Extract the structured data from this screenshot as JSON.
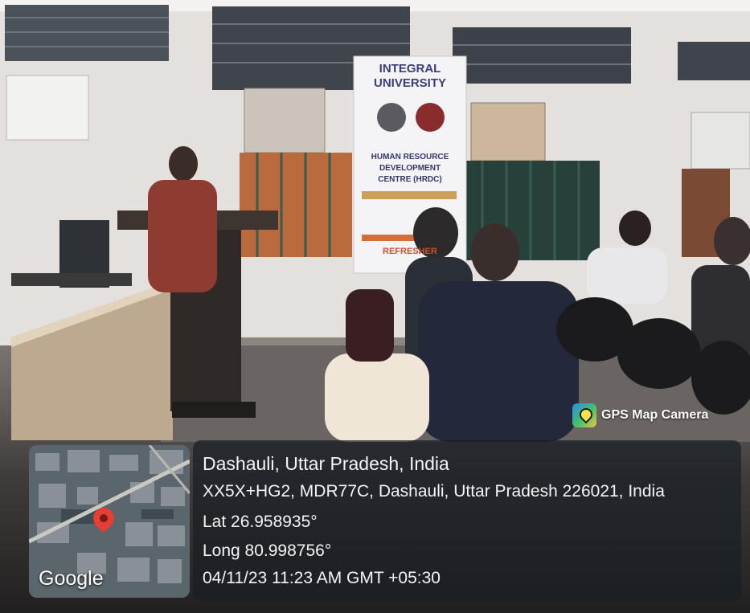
{
  "photo": {
    "banner": {
      "line1": "INTEGRAL",
      "line2": "UNIVERSITY",
      "line3": "HUMAN RESOURCE",
      "line4": "DEVELOPMENT",
      "line5": "CENTRE (HRDC)",
      "line6": "REFRESHER"
    }
  },
  "badge": {
    "icon": "gps-pin-icon",
    "label": "GPS Map Camera"
  },
  "map": {
    "provider": "Google",
    "pin_color": "#e33f35"
  },
  "location": {
    "place": "Dashauli, Uttar Pradesh, India",
    "address": "XX5X+HG2, MDR77C, Dashauli, Uttar Pradesh 226021, India",
    "lat": "Lat 26.958935°",
    "long": "Long 80.998756°",
    "timestamp": "04/11/23 11:23 AM GMT +05:30"
  }
}
